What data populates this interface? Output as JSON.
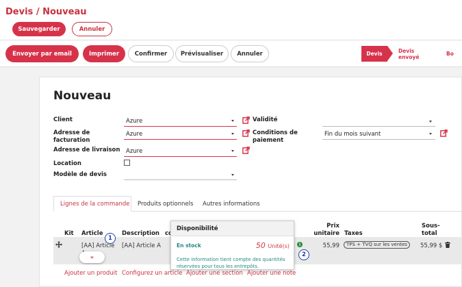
{
  "breadcrumb": {
    "parent": "Devis",
    "separator": "/",
    "current": "Nouveau"
  },
  "toolbar": {
    "save_label": "Sauvegarder",
    "cancel_label": "Annuler"
  },
  "actions": {
    "email_label": "Envoyer par email",
    "print_label": "Imprimer",
    "confirm_label": "Confirmer",
    "preview_label": "Prévisualiser",
    "cancel_label": "Annuler"
  },
  "statusbar": {
    "items": [
      "Devis",
      "Devis envoyé",
      "Bo"
    ]
  },
  "form": {
    "title": "Nouveau",
    "client_label": "Client",
    "client_value": "Azure",
    "billing_label": "Adresse de facturation",
    "billing_value": "Azure",
    "shipping_label": "Adresse de livraison",
    "shipping_value": "Azure",
    "rental_label": "Location",
    "template_label": "Modèle de devis",
    "validity_label": "Validité",
    "validity_value": "",
    "payment_label": "Conditions de paiement",
    "payment_value": "Fin du mois suivant"
  },
  "tabs": [
    "Lignes de la commande",
    "Produits optionnels",
    "Autres informations"
  ],
  "table": {
    "headers": {
      "kit": "Kit",
      "article": "Article",
      "description": "Description",
      "qty_fragment": "co",
      "price": "Prix unitaire",
      "taxes": "Taxes",
      "subtotal": "Sous-total"
    },
    "rows": [
      {
        "article": "[AA] Article A",
        "description": "[AA] Article A",
        "price": "55,99",
        "tax": "TPS + TVQ sur les ventes",
        "subtotal": "55,99 $"
      }
    ]
  },
  "add_links": [
    "Ajouter un produit",
    "Configurez un article",
    "Ajouter une section",
    "Ajouter une note"
  ],
  "popover": {
    "title": "Disponibilité",
    "status": "En stock",
    "qty": "50",
    "unit": "Unité(s)",
    "info": "Cette information tient compte des quantités réservées pour tous les entrepôts."
  },
  "annotations": {
    "badge1": "1",
    "badge2": "2"
  },
  "row_pill": "»",
  "info_dot": "i",
  "colors": {
    "accent": "#d6334a",
    "stock_text": "#1f8b80",
    "badge": "#1f3fa8"
  }
}
